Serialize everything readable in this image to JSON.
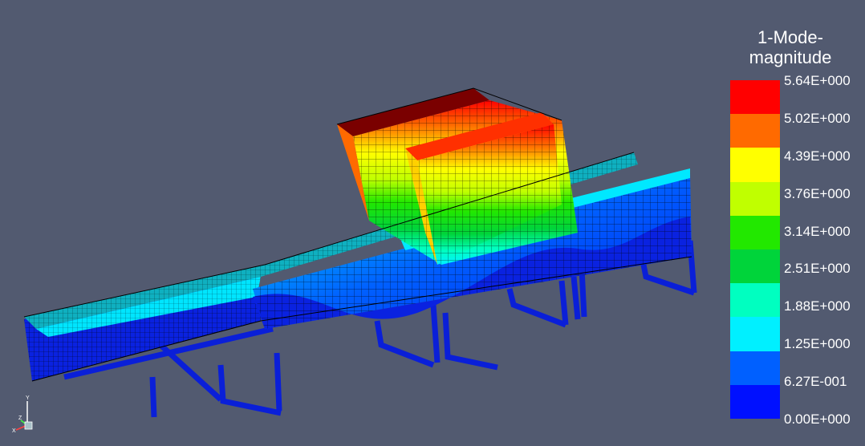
{
  "legend": {
    "title_line1": "1-Mode-",
    "title_line2": "magnitude",
    "ticks": [
      "5.64E+000",
      "5.02E+000",
      "4.39E+000",
      "3.76E+000",
      "3.14E+000",
      "2.51E+000",
      "1.88E+000",
      "1.25E+000",
      "6.27E-001",
      "0.00E+000"
    ],
    "colors": [
      "#ff0000",
      "#ff6a00",
      "#ffff00",
      "#c0ff00",
      "#22e800",
      "#00d43a",
      "#00ffc0",
      "#00f0ff",
      "#0060ff",
      "#0010ff"
    ]
  },
  "colors": {
    "background": "#525a70",
    "mesh_line": "#000000",
    "frame_blue": "#0a1fd8"
  },
  "axes": {
    "x": "X",
    "y": "Y",
    "z": "Z"
  }
}
